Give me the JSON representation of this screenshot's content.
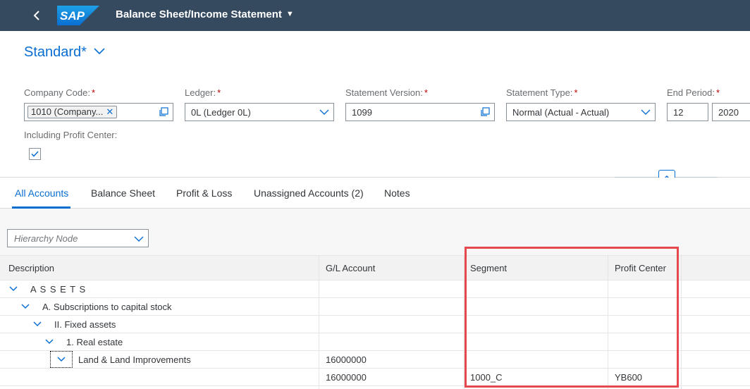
{
  "shell": {
    "title": "Balance Sheet/Income Statement",
    "logo_text": "SAP",
    "brand_color": "#0a6ed1"
  },
  "header": {
    "variant": "Standard*",
    "fields": {
      "company_code": {
        "label": "Company Code:",
        "token": "1010 (Company...",
        "required": "*"
      },
      "ledger": {
        "label": "Ledger:",
        "value": "0L (Ledger 0L)",
        "required": "*"
      },
      "statement_version": {
        "label": "Statement Version:",
        "value": "1099",
        "required": "*"
      },
      "statement_type": {
        "label": "Statement Type:",
        "value": "Normal (Actual - Actual)",
        "required": "*"
      },
      "end_period": {
        "label": "End Period:",
        "period": "12",
        "year": "2020",
        "required": "*"
      }
    },
    "including_profit_center": {
      "label": "Including Profit Center:",
      "checked": true
    }
  },
  "tabs": [
    "All Accounts",
    "Balance Sheet",
    "Profit & Loss",
    "Unassigned Accounts (2)",
    "Notes"
  ],
  "hierarchy_node": {
    "placeholder": "Hierarchy Node"
  },
  "table": {
    "columns": [
      "Description",
      "G/L Account",
      "Segment",
      "Profit Center"
    ],
    "rows": [
      {
        "description": "A S S E T S",
        "gl": "",
        "segment": "",
        "profit_center": ""
      },
      {
        "description": "A. Subscriptions to capital stock",
        "gl": "",
        "segment": "",
        "profit_center": ""
      },
      {
        "description": "II. Fixed assets",
        "gl": "",
        "segment": "",
        "profit_center": ""
      },
      {
        "description": "1. Real estate",
        "gl": "",
        "segment": "",
        "profit_center": ""
      },
      {
        "description": "Land & Land Improvements",
        "gl": "16000000",
        "segment": "",
        "profit_center": ""
      },
      {
        "description": "",
        "gl": "16000000",
        "segment": "1000_C",
        "profit_center": "YB600"
      }
    ]
  },
  "annotation_color": "#e5484d"
}
